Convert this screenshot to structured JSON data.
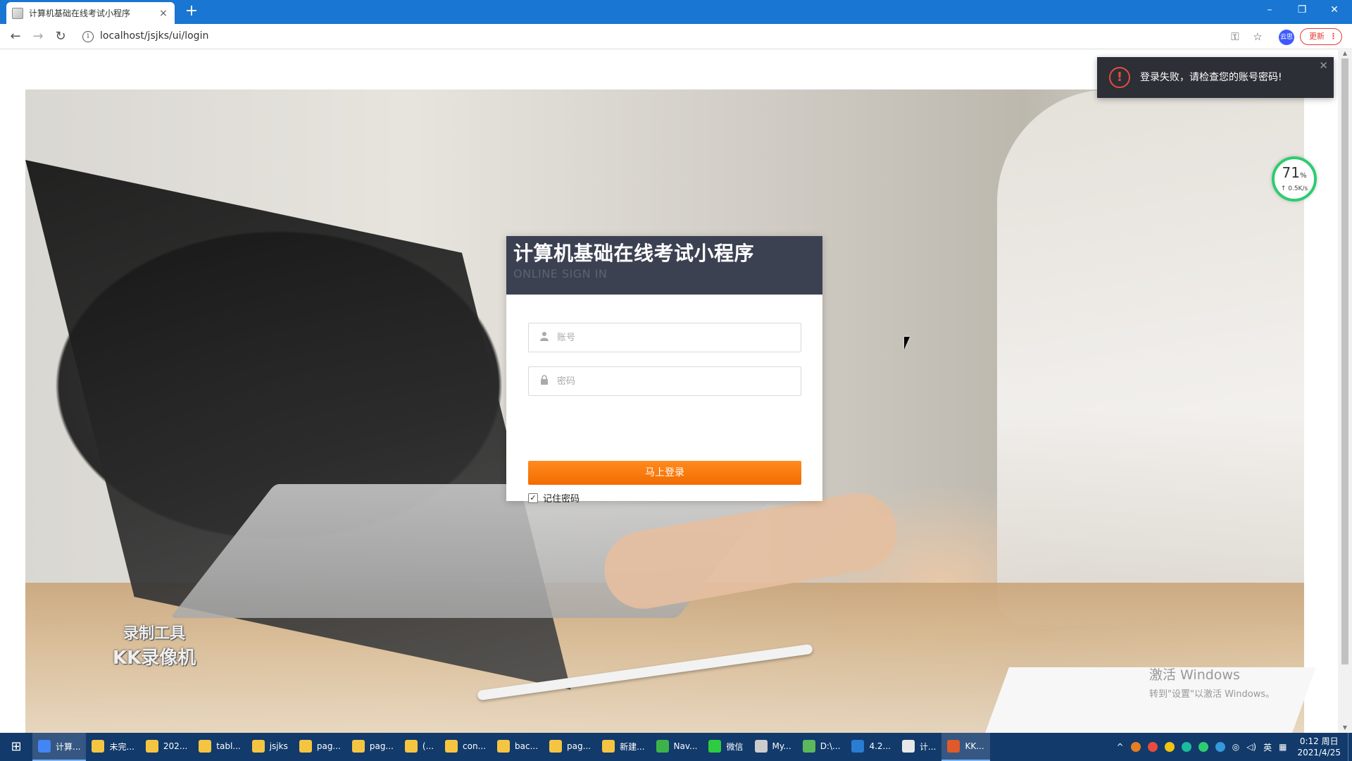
{
  "browser": {
    "tab_title": "计算机基础在线考试小程序",
    "tab_close": "×",
    "new_tab": "+",
    "url": "localhost/jsjks/ui/login",
    "update_label": "更新",
    "avatar_text": "云思",
    "window_controls": {
      "minimize": "–",
      "restore": "❐",
      "close": "✕"
    }
  },
  "login": {
    "title": "计算机基础在线考试小程序",
    "subtitle": "ONLINE SIGN IN",
    "username_placeholder": "账号",
    "password_placeholder": "密码",
    "submit_label": "马上登录",
    "remember_label": "记住密码",
    "remember_checked": true
  },
  "toast": {
    "message": "登录失败，请检查您的账号密码!",
    "icon_glyph": "!",
    "close_glyph": "✕"
  },
  "net_widget": {
    "percent": "71",
    "percent_unit": "%",
    "speed": "↑ 0.5K/s"
  },
  "watermarks": {
    "recorder_line1": "录制工具",
    "recorder_line2": "KK录像机",
    "windows_line1": "激活 Windows",
    "windows_line2": "转到\"设置\"以激活 Windows。"
  },
  "taskbar": {
    "items": [
      {
        "label": "计算...",
        "color": "#4285f4",
        "active": true
      },
      {
        "label": "未完...",
        "color": "#f5c542"
      },
      {
        "label": "202...",
        "color": "#f5c542"
      },
      {
        "label": "tabl...",
        "color": "#f5c542"
      },
      {
        "label": "jsjks",
        "color": "#f5c542"
      },
      {
        "label": "pag...",
        "color": "#f5c542"
      },
      {
        "label": "pag...",
        "color": "#f5c542"
      },
      {
        "label": "(...",
        "color": "#f5c542"
      },
      {
        "label": "con...",
        "color": "#f5c542"
      },
      {
        "label": "bac...",
        "color": "#f5c542"
      },
      {
        "label": "pag...",
        "color": "#f5c542"
      },
      {
        "label": "新建...",
        "color": "#f5c542"
      },
      {
        "label": "Nav...",
        "color": "#3cb34a"
      },
      {
        "label": "微信",
        "color": "#2ecc40"
      },
      {
        "label": "My...",
        "color": "#cccccc"
      },
      {
        "label": "D:\\...",
        "color": "#5cb85c"
      },
      {
        "label": "4.2...",
        "color": "#2b7cd3"
      },
      {
        "label": "计...",
        "color": "#e8e8e8"
      },
      {
        "label": "KK...",
        "color": "#e05a2a",
        "active": true
      }
    ],
    "tray_lang": "英",
    "time": "0:12 周日",
    "date": "2021/4/25"
  }
}
